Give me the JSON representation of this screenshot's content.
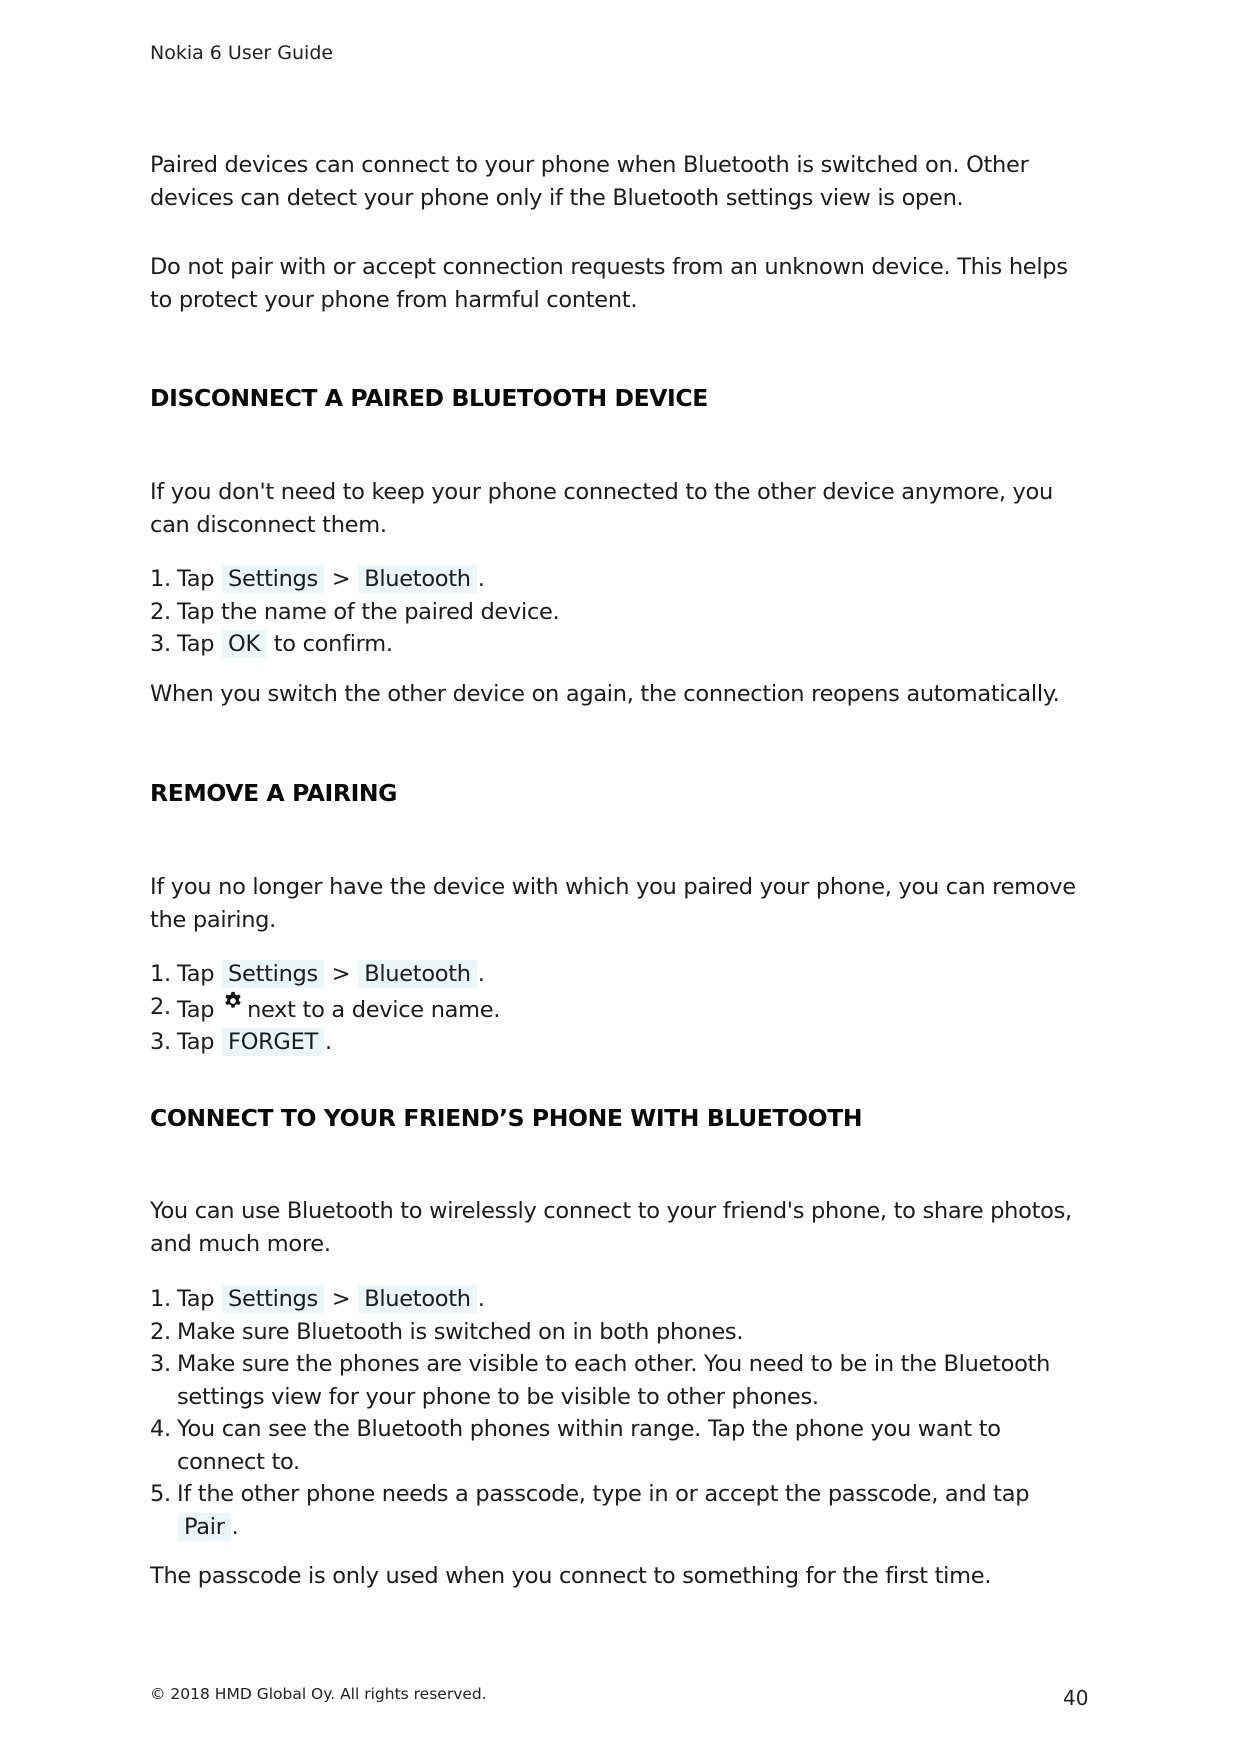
{
  "header": {
    "title": "Nokia 6 User Guide"
  },
  "intro": {
    "paragraphs": [
      "Paired devices can connect to your phone when Bluetooth is switched on. Other devices can detect your phone only if the Bluetooth settings view is open.",
      "Do not pair with or accept connection requests from an unknown device. This helps to protect your phone from harmful content."
    ]
  },
  "sections": [
    {
      "heading": "DISCONNECT A PAIRED BLUETOOTH DEVICE",
      "intro": "If you don't need to keep your phone connected to the other device anymore, you can disconnect them.",
      "steps": [
        {
          "num": "1.",
          "pre": "Tap ",
          "chip1": "Settings",
          "sep": " > ",
          "chip2": "Bluetooth",
          "post": "."
        },
        {
          "num": "2.",
          "text": "Tap the name of the paired device."
        },
        {
          "num": "3.",
          "pre": "Tap ",
          "chip1": "OK",
          "post": " to confirm."
        }
      ],
      "outro": "When you switch the other device on again, the connection reopens automatically."
    },
    {
      "heading": "REMOVE A PAIRING",
      "intro": "If you no longer have the device with which you paired your phone, you can remove the pairing.",
      "steps": [
        {
          "num": "1.",
          "pre": "Tap ",
          "chip1": "Settings",
          "sep": " > ",
          "chip2": "Bluetooth",
          "post": "."
        },
        {
          "num": "2.",
          "pre": "Tap",
          "icon": "gear-icon",
          "post": "next to a device name."
        },
        {
          "num": "3.",
          "pre": "Tap ",
          "chip1": "FORGET",
          "post": "."
        }
      ]
    },
    {
      "heading": "CONNECT TO YOUR FRIEND’S PHONE WITH BLUETOOTH",
      "intro": "You can use Bluetooth to wirelessly connect to your friend's phone, to share photos, and much more.",
      "steps": [
        {
          "num": "1.",
          "pre": "Tap ",
          "chip1": "Settings",
          "sep": " > ",
          "chip2": "Bluetooth",
          "post": "."
        },
        {
          "num": "2.",
          "text": "Make sure Bluetooth is switched on in both phones."
        },
        {
          "num": "3.",
          "text": "Make sure the phones are visible to each other. You need to be in the Bluetooth settings view for your phone to be visible to other phones."
        },
        {
          "num": "4.",
          "text": "You can see the Bluetooth phones within range. Tap the phone you want to connect to."
        },
        {
          "num": "5.",
          "pre": "If the other phone needs a passcode, type in or accept the passcode, and tap ",
          "chip1": "Pair",
          "post": "."
        }
      ],
      "outro": "The passcode is only used when you connect to something for the first time."
    }
  ],
  "footer": {
    "copyright": "© 2018 HMD Global Oy. All rights reserved.",
    "page_number": "40"
  },
  "colors": {
    "chip_background": "#eaf6f8",
    "text": "#1c1c1c"
  }
}
